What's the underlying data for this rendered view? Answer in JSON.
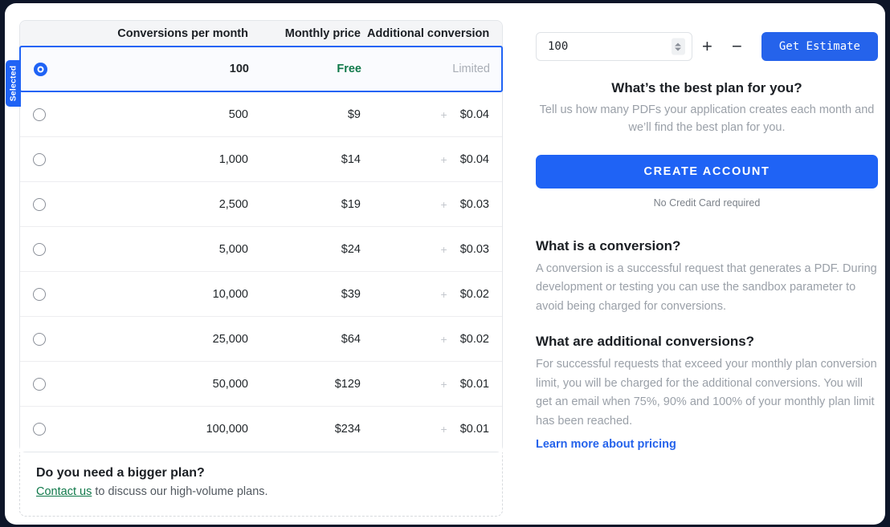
{
  "pricing_table": {
    "columns": [
      "",
      "Conversions per month",
      "Monthly price",
      "Additional conversion"
    ],
    "selected_badge": "Selected",
    "selected_index": 0,
    "rows": [
      {
        "conversions": "100",
        "price": "Free",
        "plus": "",
        "additional": "Limited",
        "selected": true
      },
      {
        "conversions": "500",
        "price": "$9",
        "plus": "+",
        "additional": "$0.04",
        "selected": false
      },
      {
        "conversions": "1,000",
        "price": "$14",
        "plus": "+",
        "additional": "$0.04",
        "selected": false
      },
      {
        "conversions": "2,500",
        "price": "$19",
        "plus": "+",
        "additional": "$0.03",
        "selected": false
      },
      {
        "conversions": "5,000",
        "price": "$24",
        "plus": "+",
        "additional": "$0.03",
        "selected": false
      },
      {
        "conversions": "10,000",
        "price": "$39",
        "plus": "+",
        "additional": "$0.02",
        "selected": false
      },
      {
        "conversions": "25,000",
        "price": "$64",
        "plus": "+",
        "additional": "$0.02",
        "selected": false
      },
      {
        "conversions": "50,000",
        "price": "$129",
        "plus": "+",
        "additional": "$0.01",
        "selected": false
      },
      {
        "conversions": "100,000",
        "price": "$234",
        "plus": "+",
        "additional": "$0.01",
        "selected": false
      }
    ]
  },
  "bigger_plan": {
    "title": "Do you need a bigger plan?",
    "link_label": "Contact us",
    "text_after_link": " to discuss our high-volume plans."
  },
  "estimator": {
    "input_value": "100",
    "input_placeholder": "100",
    "spinner_icon": "spinner-up-down-icon",
    "increment_label": "+",
    "decrement_label": "−",
    "get_estimate_label": "Get Estimate"
  },
  "promo": {
    "title": "What’s the best plan for you?",
    "subtitle": "Tell us how many PDFs your application creates each month and we’ll find the best plan for you.",
    "cta_label": "CREATE ACCOUNT",
    "cta_note": "No Credit Card required"
  },
  "faq": [
    {
      "question": "What is a conversion?",
      "answer": "A conversion is a successful request that generates a PDF. During development or testing you can use the sandbox parameter to avoid being charged for conversions."
    },
    {
      "question": "What are additional conversions?",
      "answer": "For successful requests that exceed your monthly plan conversion limit, you will be charged for the additional conversions. You will get an email when 75%, 90% and 100% of your monthly plan limit has been reached."
    }
  ],
  "learn_more": {
    "label": "Learn more about pricing"
  },
  "colors": {
    "accent_blue": "#1f63f5",
    "link_blue": "#2563eb",
    "free_green": "#10794a",
    "contact_green": "#10794a",
    "muted_gray": "#9aa0a8",
    "page_backdrop": "#0d1528"
  }
}
